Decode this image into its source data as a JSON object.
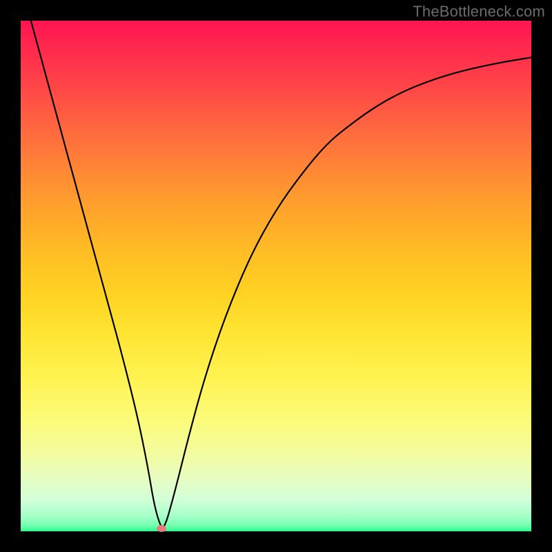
{
  "watermark": "TheBottleneck.com",
  "chart_data": {
    "type": "line",
    "title": "",
    "xlabel": "",
    "ylabel": "",
    "xlim": [
      0,
      100
    ],
    "ylim": [
      0,
      100
    ],
    "grid": false,
    "series": [
      {
        "name": "curve",
        "x": [
          2,
          5,
          8,
          11,
          14,
          17,
          20,
          23,
          25,
          26,
          27,
          28,
          30,
          33,
          36,
          40,
          45,
          50,
          55,
          60,
          65,
          70,
          75,
          80,
          85,
          90,
          95,
          100
        ],
        "values": [
          100,
          89,
          78,
          67,
          56,
          45,
          34,
          22,
          12,
          6,
          2,
          0,
          7,
          19,
          30,
          42,
          54,
          63,
          70,
          76,
          80,
          83.5,
          86.2,
          88.2,
          89.8,
          91,
          92,
          92.8
        ]
      }
    ],
    "marker": {
      "x": 27.5,
      "y": 0.5
    },
    "background_gradient": {
      "top": "#ff1451",
      "bottom": "#29f98c"
    }
  }
}
